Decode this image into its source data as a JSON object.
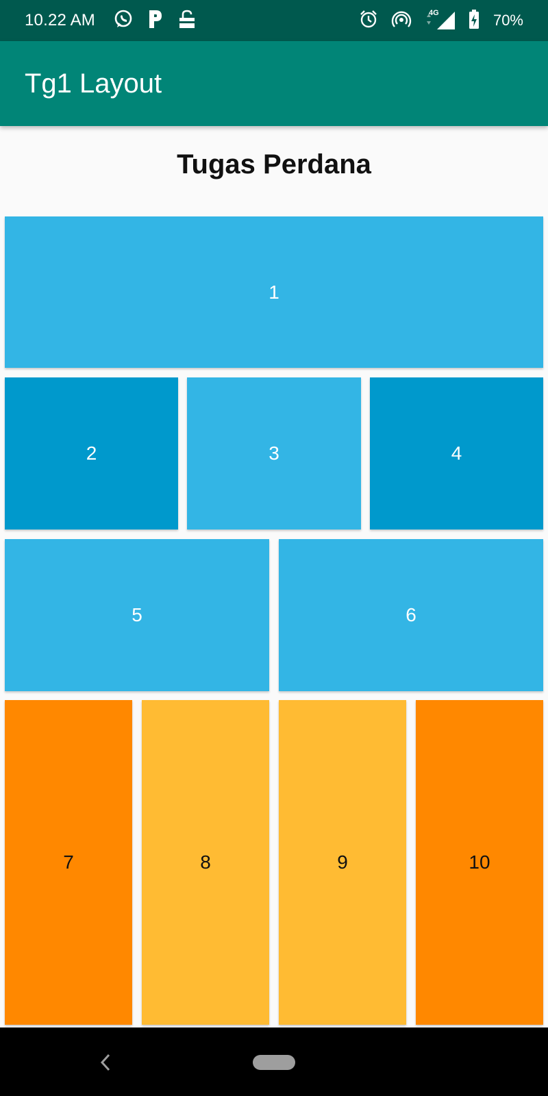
{
  "status_bar": {
    "time": "10.22 AM",
    "left_icons": [
      "whatsapp-icon",
      "parking-icon",
      "lock-download-icon"
    ],
    "right_icons": [
      "alarm-icon",
      "hotspot-icon",
      "signal-4g-icon",
      "battery-charging-icon"
    ],
    "network_type": "4G",
    "battery": "70%"
  },
  "app_bar": {
    "title": "Tg1 Layout",
    "color": "#018577"
  },
  "main": {
    "heading": "Tugas Perdana",
    "cells": [
      {
        "label": "1",
        "color": "#33b5e5"
      },
      {
        "label": "2",
        "color": "#0099cc"
      },
      {
        "label": "3",
        "color": "#33b5e5"
      },
      {
        "label": "4",
        "color": "#0099cc"
      },
      {
        "label": "5",
        "color": "#33b5e5"
      },
      {
        "label": "6",
        "color": "#33b5e5"
      },
      {
        "label": "7",
        "color": "#ff8800"
      },
      {
        "label": "8",
        "color": "#ffbb33"
      },
      {
        "label": "9",
        "color": "#ffbb33"
      },
      {
        "label": "10",
        "color": "#ff8800"
      }
    ]
  },
  "nav_bar": {
    "icons": [
      "back-icon",
      "home-pill-icon"
    ]
  }
}
